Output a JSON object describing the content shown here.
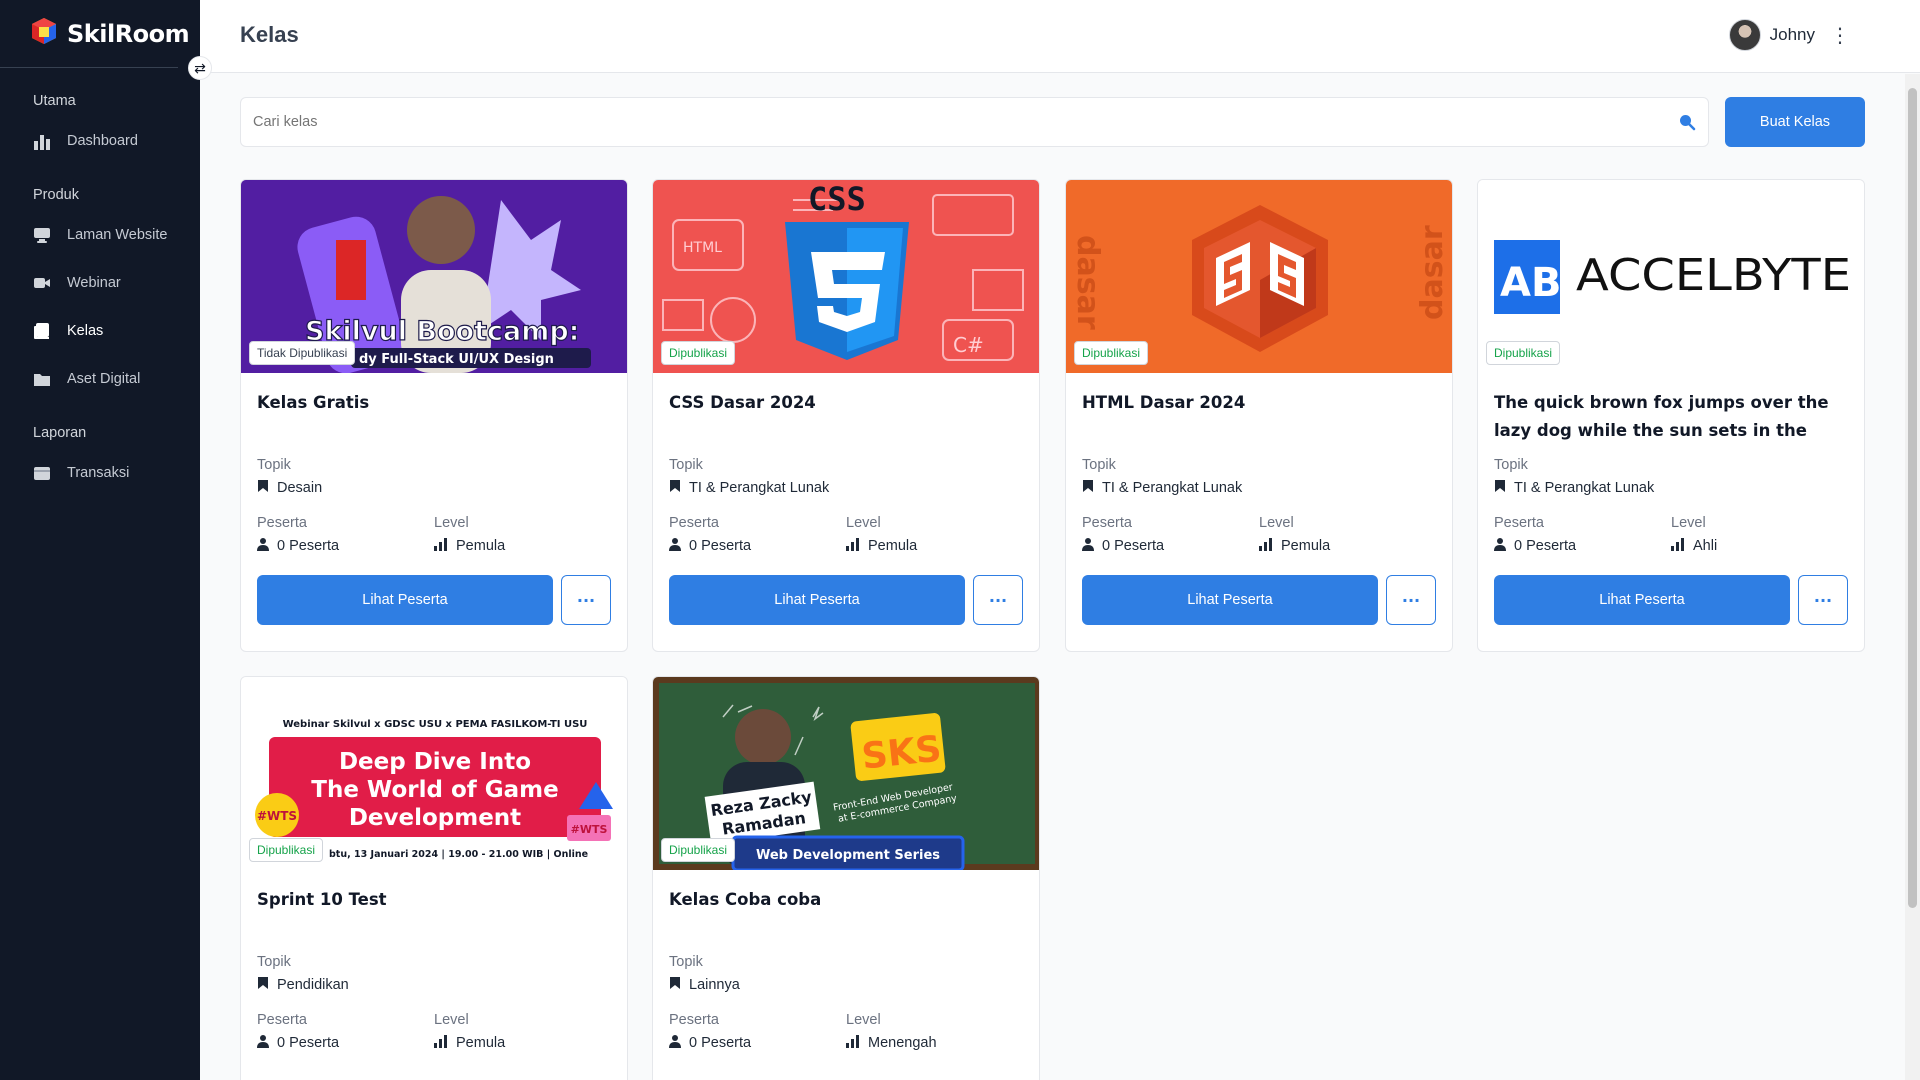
{
  "app": {
    "name": "SkilRoom"
  },
  "sidebar": {
    "sections": [
      {
        "title": "Utama",
        "items": [
          {
            "label": "Dashboard",
            "icon": "bar-chart-icon"
          }
        ]
      },
      {
        "title": "Produk",
        "items": [
          {
            "label": "Laman Website",
            "icon": "monitor-icon"
          },
          {
            "label": "Webinar",
            "icon": "video-icon"
          },
          {
            "label": "Kelas",
            "icon": "book-icon",
            "active": true
          },
          {
            "label": "Aset Digital",
            "icon": "folder-icon"
          }
        ]
      },
      {
        "title": "Laporan",
        "items": [
          {
            "label": "Transaksi",
            "icon": "wallet-icon"
          }
        ]
      }
    ]
  },
  "header": {
    "title": "Kelas",
    "user_name": "Johny"
  },
  "search": {
    "placeholder": "Cari kelas",
    "value": ""
  },
  "toolbar": {
    "create_label": "Buat Kelas"
  },
  "labels": {
    "topic": "Topik",
    "participants": "Peserta",
    "level": "Level",
    "view_participants": "Lihat Peserta",
    "more": "···"
  },
  "courses": [
    {
      "title": "Kelas Gratis",
      "status": "Tidak Dipublikasi",
      "topic": "Desain",
      "participants": "0 Peserta",
      "level": "Pemula",
      "thumb_text": [
        "Skilvul Bootcamp:",
        "dy Full-Stack UI/UX Design"
      ]
    },
    {
      "title": "CSS Dasar 2024",
      "status": "Dipublikasi",
      "topic": "TI & Perangkat Lunak",
      "participants": "0 Peserta",
      "level": "Pemula",
      "thumb_text": [
        "CSS",
        "HTML",
        "C#"
      ]
    },
    {
      "title": "HTML Dasar 2024",
      "status": "Dipublikasi",
      "topic": "TI & Perangkat Lunak",
      "participants": "0 Peserta",
      "level": "Pemula",
      "thumb_text": [
        "dasar",
        "dasar"
      ]
    },
    {
      "title": "The quick brown fox jumps over the lazy dog while the sun sets in the distant...",
      "status": "Dipublikasi",
      "topic": "TI & Perangkat Lunak",
      "participants": "0 Peserta",
      "level": "Ahli",
      "thumb_text": [
        "ACCELBYTE"
      ]
    },
    {
      "title": "Sprint 10 Test",
      "status": "Dipublikasi",
      "topic": "Pendidikan",
      "participants": "0 Peserta",
      "level": "Pemula",
      "thumb_text": [
        "Webinar Skilvul x GDSC USU x PEMA FASILKOM-TI USU",
        "Deep Dive Into",
        "The World of Game",
        "Development",
        "btu, 13 Januari 2024 | 19.00 - 21.00 WIB | Online"
      ]
    },
    {
      "title": "Kelas Coba coba",
      "status": "Dipublikasi",
      "topic": "Lainnya",
      "participants": "0 Peserta",
      "level": "Menengah",
      "thumb_text": [
        "Reza Zacky",
        "Ramadan",
        "Front-End Web Developer",
        "at E-commerce Company",
        "Web Development Series"
      ]
    }
  ],
  "colors": {
    "primary": "#2f7ee3",
    "sidebar": "#111827",
    "published": "#16a34a"
  }
}
